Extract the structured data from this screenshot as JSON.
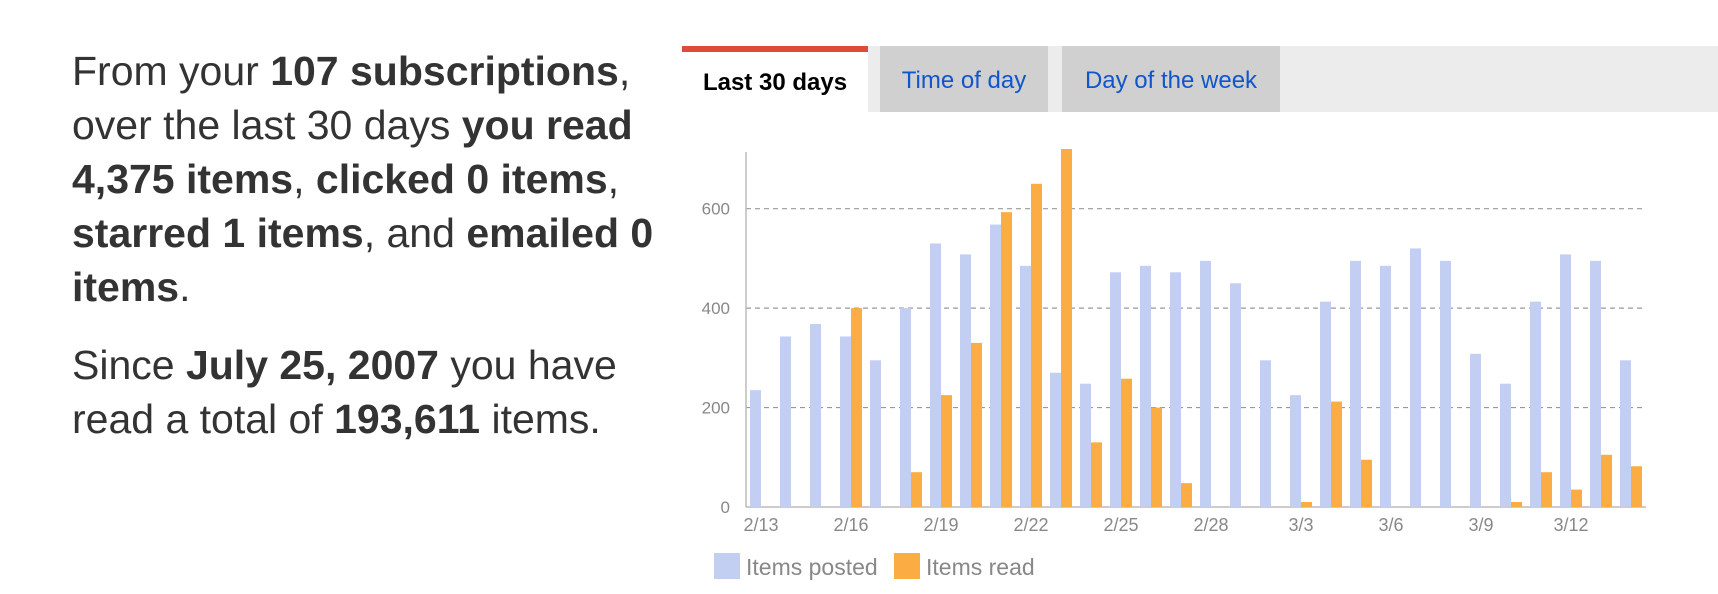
{
  "summary": {
    "p1": {
      "t1": "From your ",
      "b1": "107 subscriptions",
      "t2": ", over the last 30 days ",
      "b2": "you read 4,375 items",
      "t3": ", ",
      "b3": "clicked 0 items",
      "t4": ", ",
      "b4": "starred 1 items",
      "t5": ", and ",
      "b5": "emailed 0 items",
      "t6": "."
    },
    "p2": {
      "t1": "Since ",
      "b1": "July 25, 2007",
      "t2": " you have read a total of ",
      "b2": "193,611",
      "t3": " items."
    }
  },
  "tabs": [
    {
      "label": "Last 30 days",
      "active": true
    },
    {
      "label": "Time of day",
      "active": false
    },
    {
      "label": "Day of the week",
      "active": false
    }
  ],
  "colors": {
    "active_tab_accent": "#dd4b39",
    "link": "#1155cc",
    "posted": "#c3cff2",
    "read": "#fbac43"
  },
  "chart_data": {
    "type": "bar",
    "categories": [
      "2/13",
      "2/14",
      "2/15",
      "2/16",
      "2/17",
      "2/18",
      "2/19",
      "2/20",
      "2/21",
      "2/22",
      "2/23",
      "2/24",
      "2/25",
      "2/26",
      "2/27",
      "2/28",
      "3/1",
      "3/2",
      "3/3",
      "3/4",
      "3/5",
      "3/6",
      "3/7",
      "3/8",
      "3/9",
      "3/10",
      "3/11",
      "3/12",
      "3/13",
      "3/14"
    ],
    "tick_labels": [
      "2/13",
      "2/16",
      "2/19",
      "2/22",
      "2/25",
      "2/28",
      "3/3",
      "3/6",
      "3/9",
      "3/12"
    ],
    "series": [
      {
        "name": "Items posted",
        "values": [
          235,
          343,
          368,
          343,
          295,
          400,
          530,
          508,
          568,
          485,
          270,
          248,
          472,
          485,
          472,
          495,
          450,
          295,
          225,
          413,
          495,
          485,
          520,
          495,
          308,
          248,
          413,
          508,
          495,
          295
        ]
      },
      {
        "name": "Items read",
        "values": [
          0,
          0,
          0,
          400,
          0,
          70,
          225,
          330,
          593,
          650,
          720,
          130,
          258,
          200,
          48,
          0,
          0,
          0,
          10,
          212,
          95,
          0,
          0,
          0,
          0,
          10,
          70,
          35,
          105,
          82
        ]
      }
    ],
    "yticks": [
      0,
      200,
      400,
      600
    ],
    "ylim": [
      0,
      720
    ],
    "grid": true,
    "legend_position": "bottom-left"
  }
}
